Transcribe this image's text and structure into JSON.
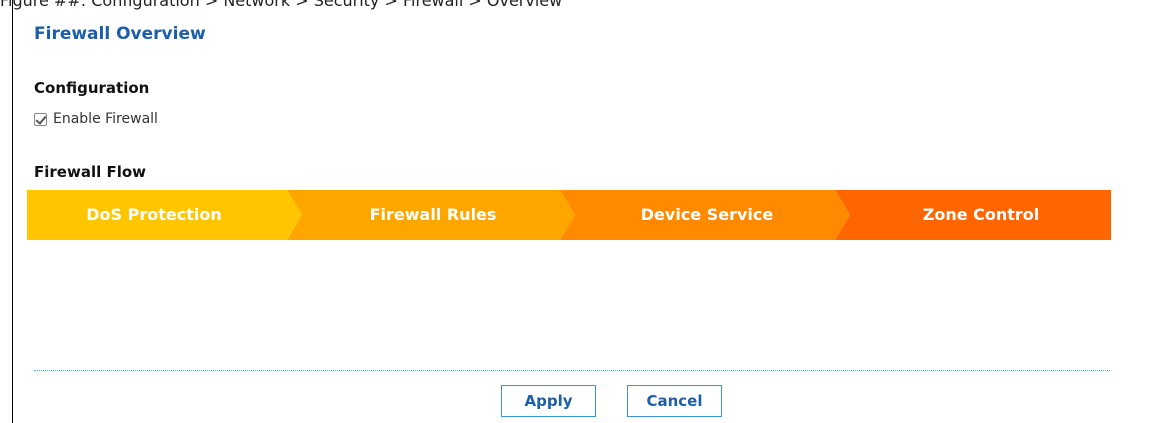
{
  "caption": "Figure ##: Configuration > Network > Security > Firewall > Overview",
  "page": {
    "title": "Firewall Overview"
  },
  "configuration": {
    "title": "Configuration",
    "enable_firewall": {
      "label": "Enable Firewall",
      "checked": true
    }
  },
  "firewall_flow": {
    "title": "Firewall Flow",
    "steps": [
      {
        "label": "DoS Protection",
        "color": "#ffc600"
      },
      {
        "label": "Firewall Rules",
        "color": "#ffa500"
      },
      {
        "label": "Device Service",
        "color": "#ff8a00"
      },
      {
        "label": "Zone Control",
        "color": "#ff6600"
      }
    ]
  },
  "buttons": {
    "apply": "Apply",
    "cancel": "Cancel"
  }
}
